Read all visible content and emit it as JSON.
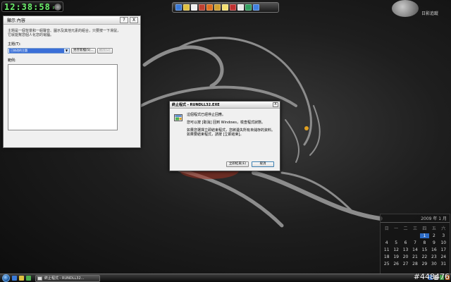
{
  "clock": {
    "time": "12:38:58",
    "ampm": "PM"
  },
  "top_toolbar": {
    "icons": [
      "monitor-icon",
      "folder-icon",
      "document-icon",
      "photo-icon",
      "media-icon",
      "music-icon",
      "note-icon",
      "mail-icon",
      "calculator-icon",
      "search-icon",
      "globe-icon"
    ]
  },
  "moon_gadget": {
    "label": "日影追蹤"
  },
  "theme_dialog": {
    "title": "顯示 內容",
    "help": "?",
    "close": "X",
    "description": "主題是一個背景和一組聲音、圖示及其他元素的組合，只要按一下滑鼠，它就能幫您個人化您的電腦。",
    "theme_label": "主題(T):",
    "theme_value": "已修改的主題",
    "save_as_button": "另存新檔(S)...",
    "delete_button": "刪除(D)",
    "sample_label": "範例:"
  },
  "stopped_dialog": {
    "title": "終止程式 - RUNDLL32.EXE",
    "close": "X",
    "line1": "這個程式已經停止回應。",
    "line2": "您可以按 [取消] 回到 Windows，檢查程式狀態。",
    "line3": "如果您選擇立即結束程式，您將遺失所有未儲存的資料。如果要結束程式，請按 [立即結束]。",
    "end_now_button": "立即結束(E)",
    "cancel_button": "取消"
  },
  "calendar": {
    "header": "2009 年 1 月",
    "days_of_week": [
      "日",
      "一",
      "二",
      "三",
      "四",
      "五",
      "六"
    ],
    "days": [
      "",
      "",
      "",
      "",
      "1",
      "2",
      "3",
      "4",
      "5",
      "6",
      "7",
      "8",
      "9",
      "10",
      "11",
      "12",
      "13",
      "14",
      "15",
      "16",
      "17",
      "18",
      "19",
      "20",
      "21",
      "22",
      "23",
      "24",
      "25",
      "26",
      "27",
      "28",
      "29",
      "30",
      "31"
    ],
    "today": "1"
  },
  "taskbar": {
    "task_item": "終止程式 - RUNDLL32...",
    "watermark": "#448476"
  },
  "colors": {
    "accent": "#2d6bc4",
    "clock_digits": "#6cf06c"
  }
}
